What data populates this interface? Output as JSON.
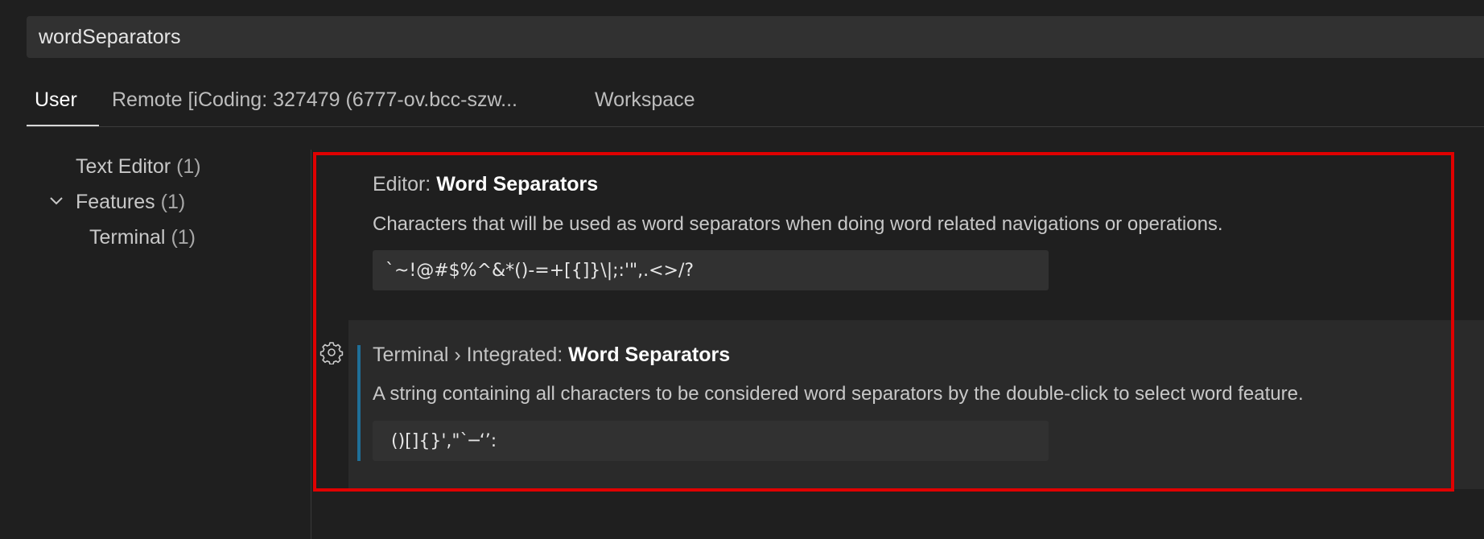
{
  "search": {
    "value": "wordSeparators"
  },
  "tabs": [
    {
      "label": "User"
    },
    {
      "label": "Remote [iCoding: 327479 (6777-ov.bcc-szw..."
    },
    {
      "label": "Workspace"
    }
  ],
  "toc": [
    {
      "label": "Text Editor",
      "count": "(1)"
    },
    {
      "label": "Features",
      "count": "(1)"
    },
    {
      "label": "Terminal",
      "count": "(1)"
    }
  ],
  "settings": [
    {
      "category": "Editor: ",
      "name": "Word Separators",
      "description": "Characters that will be used as word separators when doing word related navigations or operations.",
      "value": "`~!@#$%^&*()-=+[{]}\\|;:'\",.<>/?"
    },
    {
      "category": "Terminal › Integrated: ",
      "name": "Word Separators",
      "description": "A string containing all characters to be considered word separators by the double-click to select word feature.",
      "value": " ()[]{}',\"`─‘’:"
    }
  ],
  "icons": {
    "toc_expand": "chevron-down-icon",
    "setting_gear": "gear-icon"
  },
  "colors": {
    "background": "#1f1f1f",
    "input_background": "#313131",
    "focus_indicator": "#1f6f98",
    "highlight_frame": "#e00000"
  }
}
